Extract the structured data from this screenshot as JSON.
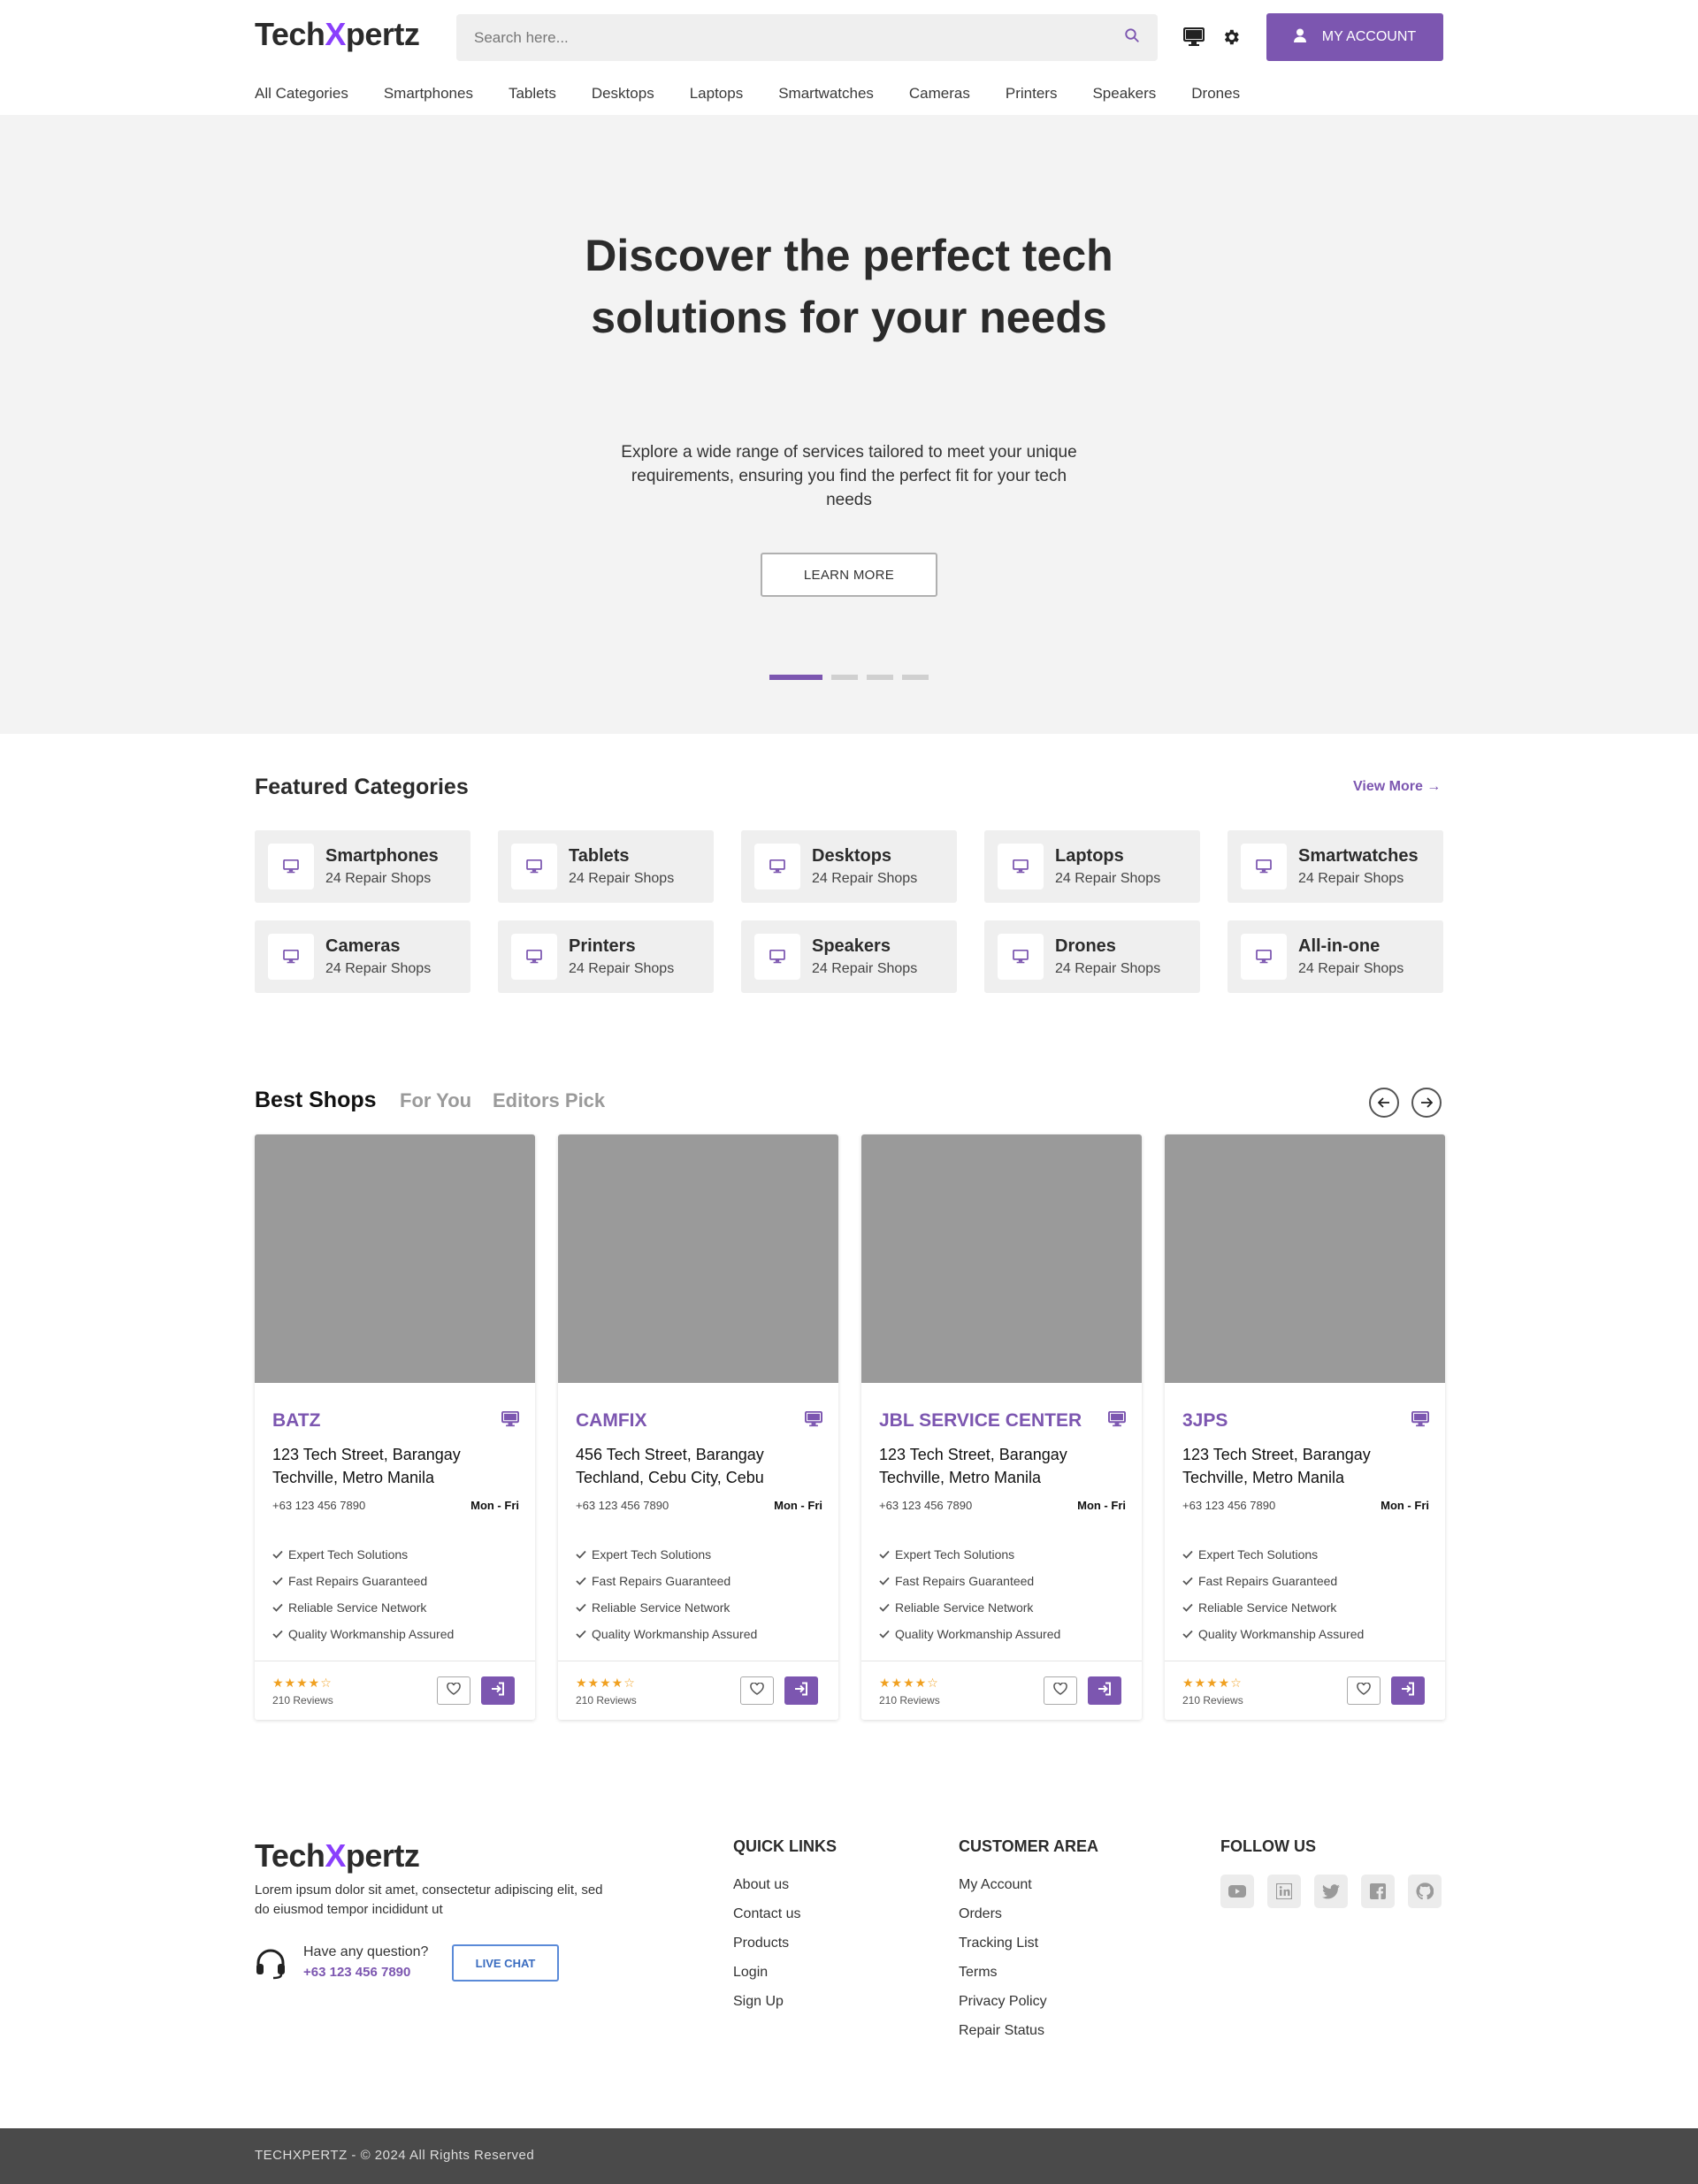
{
  "header": {
    "logo_prefix": "Tech",
    "logo_x": "X",
    "logo_suffix": "pertz",
    "search_placeholder": "Search here...",
    "account_label": "MY ACCOUNT"
  },
  "nav": [
    "All Categories",
    "Smartphones",
    "Tablets",
    "Desktops",
    "Laptops",
    "Smartwatches",
    "Cameras",
    "Printers",
    "Speakers",
    "Drones"
  ],
  "hero": {
    "title": "Discover the perfect tech solutions for your needs",
    "subtitle": "Explore a wide range of services tailored to meet your unique requirements, ensuring you find the perfect fit for your tech needs",
    "button": "LEARN MORE",
    "slides": 4,
    "active_slide": 1
  },
  "featured": {
    "title": "Featured Categories",
    "view_more": "View More",
    "categories": [
      {
        "name": "Smartphones",
        "count": "24 Repair Shops"
      },
      {
        "name": "Tablets",
        "count": "24 Repair Shops"
      },
      {
        "name": "Desktops",
        "count": "24 Repair Shops"
      },
      {
        "name": "Laptops",
        "count": "24 Repair Shops"
      },
      {
        "name": "Smartwatches",
        "count": "24 Repair Shops"
      },
      {
        "name": "Cameras",
        "count": "24 Repair Shops"
      },
      {
        "name": "Printers",
        "count": "24 Repair Shops"
      },
      {
        "name": "Speakers",
        "count": "24 Repair Shops"
      },
      {
        "name": "Drones",
        "count": "24 Repair Shops"
      },
      {
        "name": "All-in-one",
        "count": "24 Repair Shops"
      }
    ]
  },
  "shops": {
    "tabs": [
      "Best Shops",
      "For You",
      "Editors Pick"
    ],
    "active_tab": "Best Shops",
    "cards": [
      {
        "name": "BATZ",
        "address": "123 Tech Street, Barangay Techville, Metro Manila",
        "phone": "+63 123 456 7890",
        "days": "Mon - Fri",
        "features": [
          "Expert Tech Solutions",
          "Fast Repairs Guaranteed",
          "Reliable Service Network",
          "Quality Workmanship Assured"
        ],
        "stars": "★★★★☆",
        "rating": 4,
        "reviews": "210 Reviews"
      },
      {
        "name": "CAMFIX",
        "address": "456 Tech Street, Barangay Techland, Cebu City, Cebu",
        "phone": "+63 123 456 7890",
        "days": "Mon - Fri",
        "features": [
          "Expert Tech Solutions",
          "Fast Repairs Guaranteed",
          "Reliable Service Network",
          "Quality Workmanship Assured"
        ],
        "stars": "★★★★☆",
        "rating": 4,
        "reviews": "210 Reviews"
      },
      {
        "name": "JBL SERVICE CENTER",
        "address": "123 Tech Street, Barangay Techville, Metro Manila",
        "phone": "+63 123 456 7890",
        "days": "Mon - Fri",
        "features": [
          "Expert Tech Solutions",
          "Fast Repairs Guaranteed",
          "Reliable Service Network",
          "Quality Workmanship Assured"
        ],
        "stars": "★★★★☆",
        "rating": 4,
        "reviews": "210 Reviews"
      },
      {
        "name": "3JPS",
        "address": "123 Tech Street, Barangay Techville, Metro Manila",
        "phone": "+63 123 456 7890",
        "days": "Mon - Fri",
        "features": [
          "Expert Tech Solutions",
          "Fast Repairs Guaranteed",
          "Reliable Service Network",
          "Quality Workmanship Assured"
        ],
        "stars": "★★★★☆",
        "rating": 4,
        "reviews": "210 Reviews"
      }
    ]
  },
  "footer": {
    "description": "Lorem ipsum dolor sit amet, consectetur adipiscing elit, sed do eiusmod tempor incididunt ut",
    "question": "Have any question?",
    "phone": "+63 123 456 7890",
    "live_chat": "LIVE CHAT",
    "quick_links_title": "QUICK LINKS",
    "quick_links": [
      "About us",
      "Contact us",
      "Products",
      "Login",
      "Sign Up"
    ],
    "customer_area_title": "CUSTOMER AREA",
    "customer_area": [
      "My Account",
      "Orders",
      "Tracking List",
      "Terms",
      "Privacy Policy",
      "Repair Status"
    ],
    "follow_title": "FOLLOW US",
    "social": [
      "youtube-icon",
      "linkedin-icon",
      "twitter-icon",
      "facebook-icon",
      "github-icon"
    ],
    "copyright": "TECHXPERTZ - © 2024 All Rights Reserved"
  },
  "colors": {
    "accent": "#7c56b0",
    "logo_x": "#8a3ffc",
    "star": "#f0a020",
    "footer_bar": "#4a4a4a"
  }
}
